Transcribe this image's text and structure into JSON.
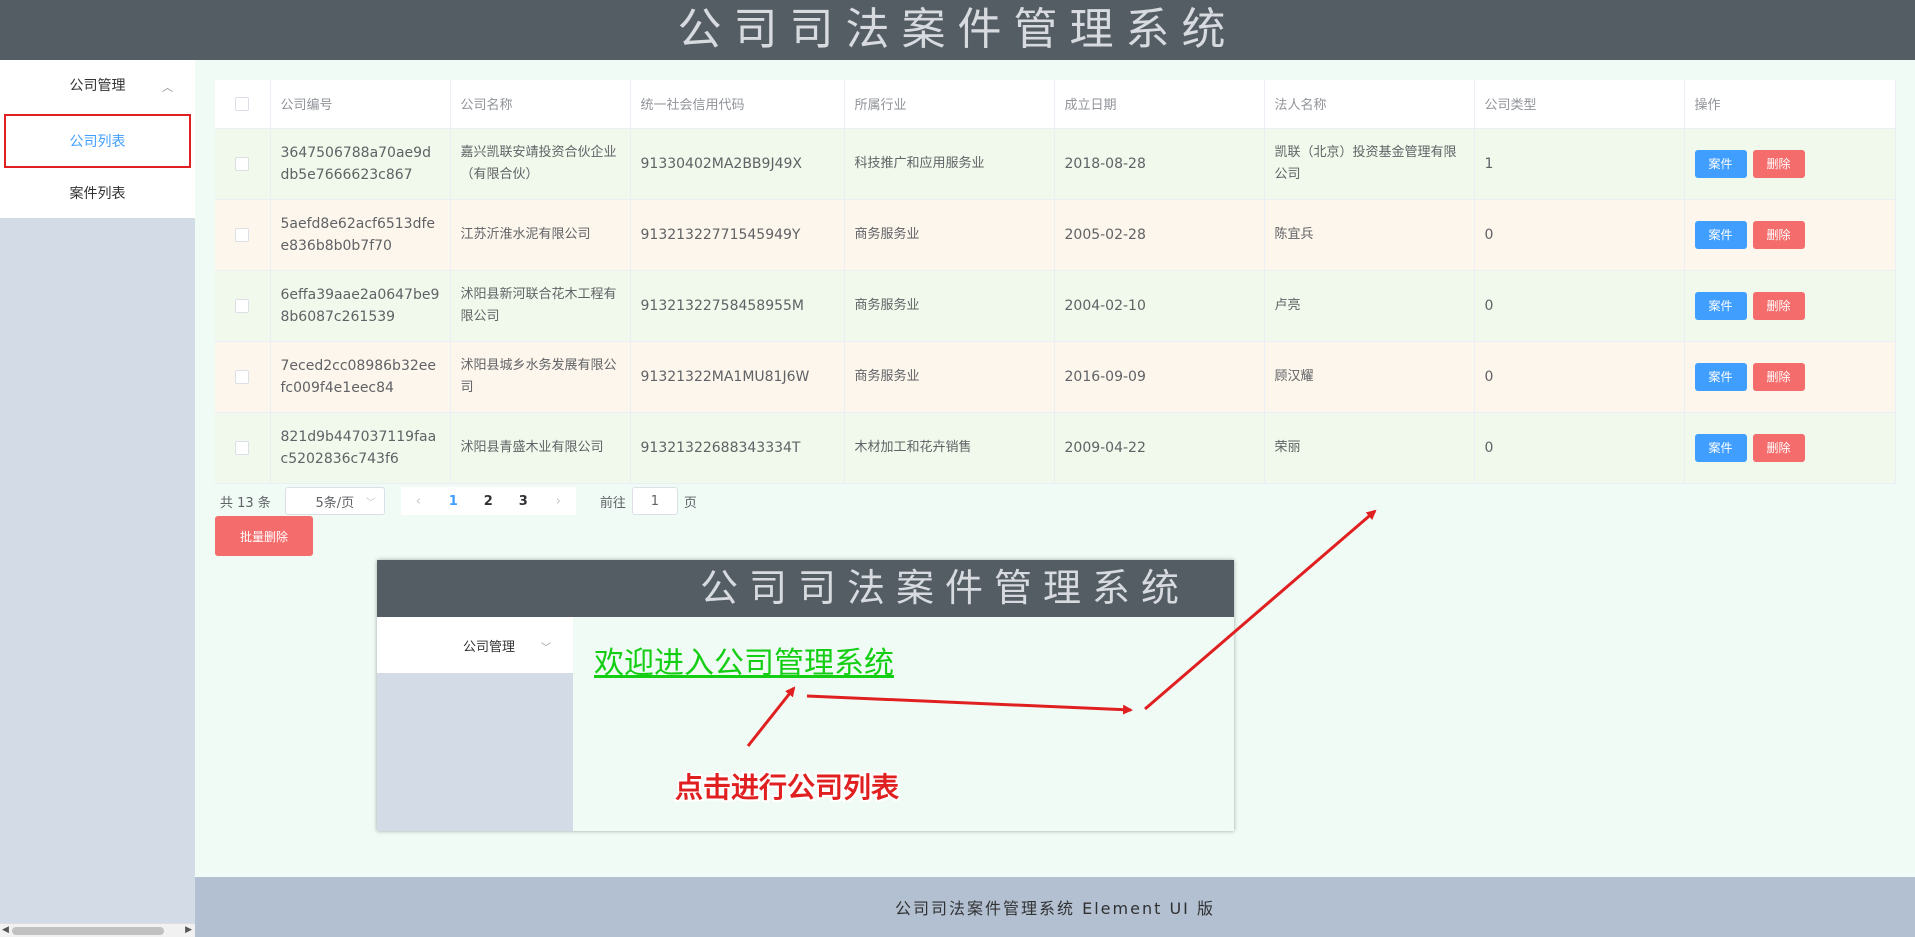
{
  "header": {
    "title": "公司司法案件管理系统"
  },
  "sidebar": {
    "group_label": "公司管理",
    "items": [
      {
        "label": "公司列表",
        "active": true
      },
      {
        "label": "案件列表",
        "active": false
      }
    ]
  },
  "table": {
    "columns": [
      "公司编号",
      "公司名称",
      "统一社会信用代码",
      "所属行业",
      "成立日期",
      "法人名称",
      "公司类型",
      "操作"
    ],
    "rows": [
      {
        "id": "3647506788a70ae9ddb5e7666623c867",
        "name": "嘉兴凯联安靖投资合伙企业（有限合伙）",
        "credit_code": "91330402MA2BB9J49X",
        "industry": "科技推广和应用服务业",
        "founded": "2018-08-28",
        "legal_person": "凯联（北京）投资基金管理有限公司",
        "type": "1"
      },
      {
        "id": "5aefd8e62acf6513dfee836b8b0b7f70",
        "name": "江苏沂淮水泥有限公司",
        "credit_code": "91321322771545949Y",
        "industry": "商务服务业",
        "founded": "2005-02-28",
        "legal_person": "陈宜兵",
        "type": "0"
      },
      {
        "id": "6effa39aae2a0647be98b6087c261539",
        "name": "沭阳县新河联合花木工程有限公司",
        "credit_code": "91321322758458955M",
        "industry": "商务服务业",
        "founded": "2004-02-10",
        "legal_person": "卢亮",
        "type": "0"
      },
      {
        "id": "7eced2cc08986b32eefc009f4e1eec84",
        "name": "沭阳县城乡水务发展有限公司",
        "credit_code": "91321322MA1MU81J6W",
        "industry": "商务服务业",
        "founded": "2016-09-09",
        "legal_person": "顾汉耀",
        "type": "0"
      },
      {
        "id": "821d9b447037119faac5202836c743f6",
        "name": "沭阳县青盛木业有限公司",
        "credit_code": "91321322688343334T",
        "industry": "木材加工和花卉销售",
        "founded": "2009-04-22",
        "legal_person": "荣丽",
        "type": "0"
      }
    ],
    "action_case": "案件",
    "action_delete": "删除"
  },
  "pagination": {
    "total": "共 13 条",
    "page_size": "5条/页",
    "pages": [
      "1",
      "2",
      "3"
    ],
    "current": "1",
    "goto_prefix": "前往",
    "goto_value": "1",
    "goto_suffix": "页"
  },
  "batch_delete": "批量删除",
  "inset": {
    "title": "公司司法案件管理系统",
    "menu_label": "公司管理",
    "welcome": "欢迎进入公司管理系统"
  },
  "annotation": "点击进行公司列表",
  "footer": "公司司法案件管理系统 Element UI 版"
}
